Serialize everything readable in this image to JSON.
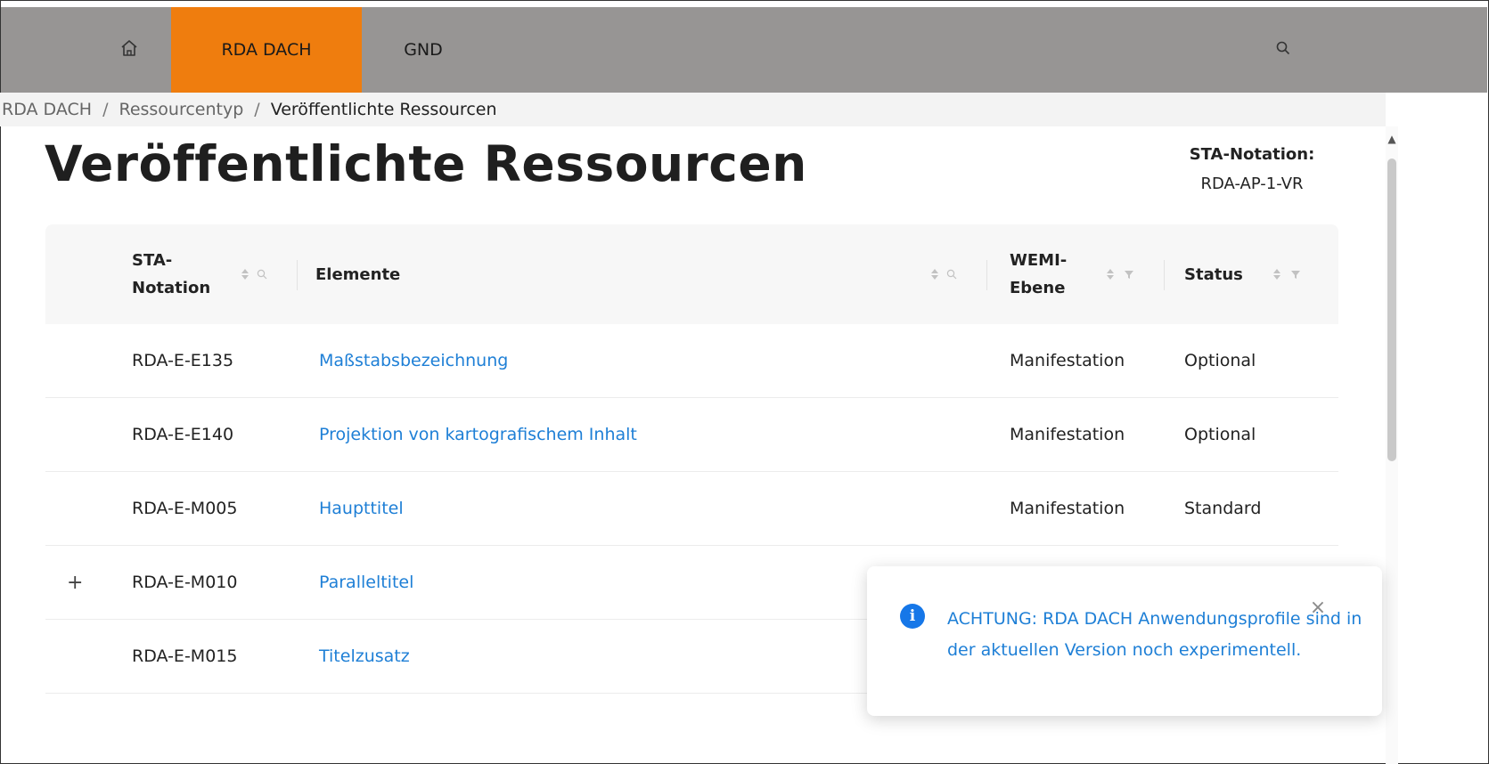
{
  "nav": {
    "home_icon": "home-icon",
    "tabs": [
      {
        "label": "RDA DACH",
        "active": true
      },
      {
        "label": "GND",
        "active": false
      }
    ],
    "search_icon": "search-icon",
    "active_color": "#ef7d0e",
    "bar_color": "#979594"
  },
  "breadcrumb": {
    "items": [
      "RDA DACH",
      "Ressourcentyp"
    ],
    "separator": "/",
    "current": "Veröffentlichte Ressourcen"
  },
  "page": {
    "title": "Veröffentlichte Ressourcen",
    "sta_label": "STA-Notation:",
    "sta_value": "RDA-AP-1-VR"
  },
  "table": {
    "headers": {
      "notation_line1": "STA-",
      "notation_line2": "Notation",
      "elemente": "Elemente",
      "wemi_line1": "WEMI-",
      "wemi_line2": "Ebene",
      "status": "Status"
    },
    "rows": [
      {
        "notation": "RDA-E-E135",
        "element": "Maßstabsbezeichnung",
        "wemi": "Manifestation",
        "status": "Optional",
        "expandable": false
      },
      {
        "notation": "RDA-E-E140",
        "element": "Projektion von kartografischem Inhalt",
        "wemi": "Manifestation",
        "status": "Optional",
        "expandable": false
      },
      {
        "notation": "RDA-E-M005",
        "element": "Haupttitel",
        "wemi": "Manifestation",
        "status": "Standard",
        "expandable": false
      },
      {
        "notation": "RDA-E-M010",
        "element": "Paralleltitel",
        "wemi": "",
        "status": "",
        "expandable": true,
        "expand_symbol": "+"
      },
      {
        "notation": "RDA-E-M015",
        "element": "Titelzusatz",
        "wemi": "",
        "status": "",
        "expandable": false
      }
    ],
    "link_color": "#1e7fd6"
  },
  "notification": {
    "icon": "info-icon",
    "icon_symbol": "i",
    "message": "ACHTUNG: RDA DACH Anwendungsprofile sind in der aktuellen Version noch experimentell.",
    "close_symbol": "×",
    "close_icon": "close-icon"
  }
}
